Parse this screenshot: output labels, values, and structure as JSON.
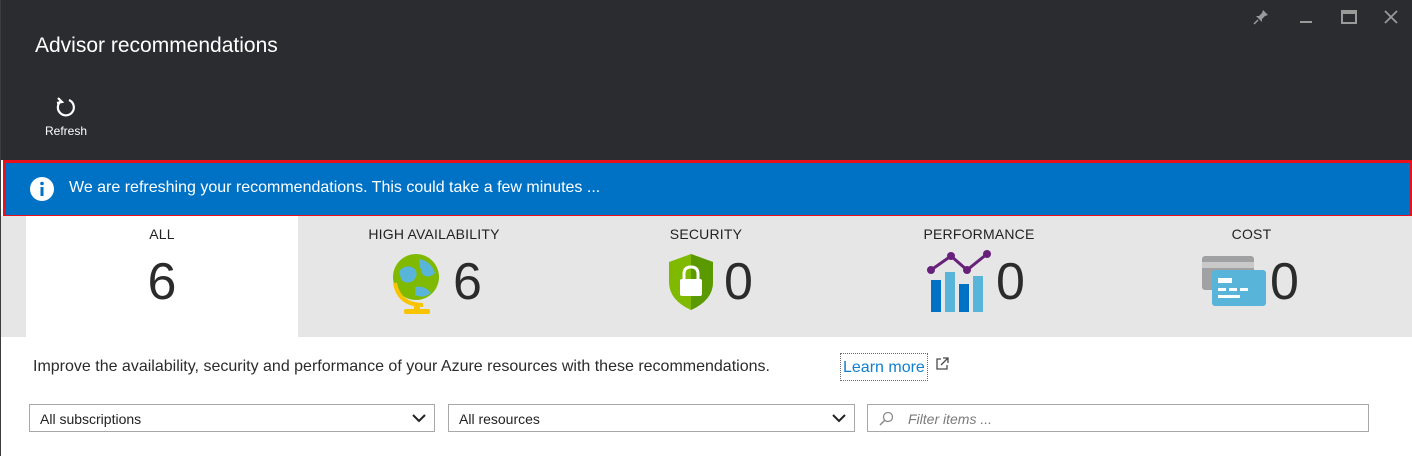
{
  "window": {
    "title": "Advisor recommendations"
  },
  "toolbar": {
    "refresh_label": "Refresh"
  },
  "notification": {
    "message": "We are refreshing your recommendations. This could take a few minutes ...",
    "border_color": "#e8111b",
    "background_color": "#0072c6"
  },
  "tiles": [
    {
      "label": "ALL",
      "count": "6",
      "icon": null,
      "active": true
    },
    {
      "label": "HIGH AVAILABILITY",
      "count": "6",
      "icon": "globe-puzzle-icon",
      "active": false
    },
    {
      "label": "SECURITY",
      "count": "0",
      "icon": "shield-lock-icon",
      "active": false
    },
    {
      "label": "PERFORMANCE",
      "count": "0",
      "icon": "bar-line-chart-icon",
      "active": false
    },
    {
      "label": "COST",
      "count": "0",
      "icon": "credit-card-icon",
      "active": false
    }
  ],
  "description": {
    "text": "Improve the availability, security and performance of your Azure resources with these recommendations.",
    "learn_more": "Learn more"
  },
  "filters": {
    "subscriptions": "All subscriptions",
    "resources": "All resources",
    "search_placeholder": "Filter items ..."
  },
  "colors": {
    "header_bg": "#2a2c2f",
    "accent_blue": "#0072c6",
    "link": "#0f7fce"
  }
}
